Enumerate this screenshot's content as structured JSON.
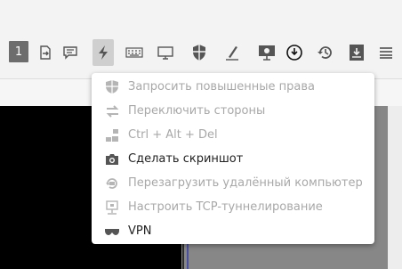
{
  "toolbar": {
    "monitor_number": "1"
  },
  "menu": {
    "items": [
      {
        "label": "Запросить повышенные права",
        "icon": "shield-icon",
        "enabled": false
      },
      {
        "label": "Переключить стороны",
        "icon": "swap-icon",
        "enabled": false
      },
      {
        "label": "Ctrl + Alt + Del",
        "icon": "keys-icon",
        "enabled": false
      },
      {
        "label": "Сделать скриншот",
        "icon": "camera-icon",
        "enabled": true
      },
      {
        "label": "Перезагрузить удалённый компьютер",
        "icon": "restart-icon",
        "enabled": false
      },
      {
        "label": "Настроить TCP-туннелирование",
        "icon": "tunnel-icon",
        "enabled": false
      },
      {
        "label": "VPN",
        "icon": "vpn-icon",
        "enabled": true
      }
    ]
  },
  "colors": {
    "toolbar_bg": "#f3f3f3",
    "icon_gray": "#555555",
    "disabled_text": "#a8a8a8",
    "enabled_text": "#222222"
  }
}
